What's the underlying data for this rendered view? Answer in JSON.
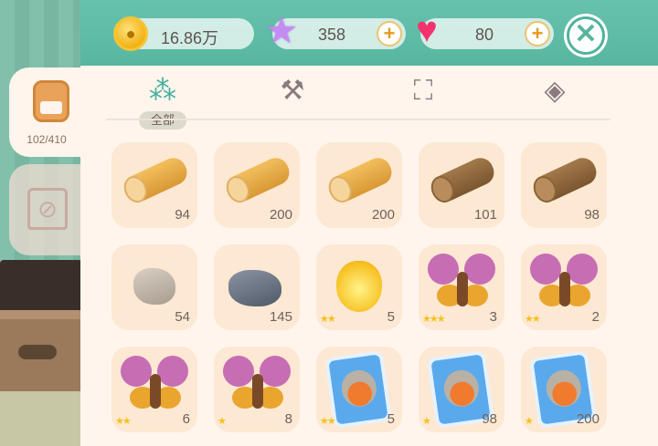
{
  "currency": {
    "coins": "16.86万",
    "stars": "358",
    "hearts": "80"
  },
  "icons": {
    "coin": "coin-icon",
    "star": "star-icon",
    "heart": "heart-icon",
    "plus": "plus-icon",
    "close": "close-icon",
    "bag": "backpack-icon",
    "shop": "shop-icon",
    "all": "dots-grid-icon",
    "materials": "toolbox-icon",
    "furniture": "chair-icon",
    "shapes": "shapes-icon"
  },
  "sidebar": {
    "bag_count": "102/410"
  },
  "category": {
    "active_label": "全部"
  },
  "colors": {
    "accent": "#58b6a0",
    "panel": "#fff5ec",
    "slot": "#fde8d3",
    "star_gold": "#f4c21e",
    "heart": "#f2336f"
  },
  "inventory": [
    {
      "item": "light-log-icon",
      "qty": "94",
      "stars": ""
    },
    {
      "item": "light-log-icon",
      "qty": "200",
      "stars": ""
    },
    {
      "item": "light-log-icon",
      "qty": "200",
      "stars": ""
    },
    {
      "item": "dark-log-icon",
      "qty": "101",
      "stars": ""
    },
    {
      "item": "dark-log-icon",
      "qty": "98",
      "stars": ""
    },
    {
      "item": "beige-rock-icon",
      "qty": "54",
      "stars": ""
    },
    {
      "item": "slate-rock-icon",
      "qty": "145",
      "stars": ""
    },
    {
      "item": "firefly-icon",
      "qty": "5",
      "stars": "★★"
    },
    {
      "item": "butterfly-icon",
      "qty": "3",
      "stars": "★★★"
    },
    {
      "item": "butterfly-icon",
      "qty": "2",
      "stars": "★★"
    },
    {
      "item": "butterfly-icon",
      "qty": "6",
      "stars": "★★"
    },
    {
      "item": "butterfly-icon",
      "qty": "8",
      "stars": "★"
    },
    {
      "item": "robin-card-icon",
      "qty": "5",
      "stars": "★★"
    },
    {
      "item": "robin-card-icon",
      "qty": "98",
      "stars": "★"
    },
    {
      "item": "robin-card-icon",
      "qty": "200",
      "stars": "★"
    }
  ]
}
